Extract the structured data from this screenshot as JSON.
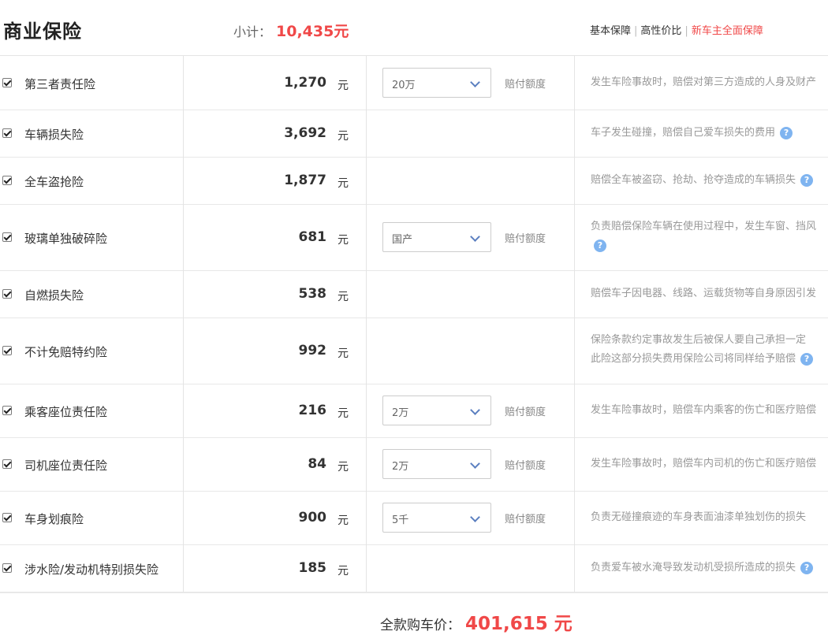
{
  "header": {
    "title": "商业保险",
    "subtotal_label": "小计：",
    "subtotal_value": "10,435元",
    "plans": [
      "基本保障",
      "高性价比",
      "新车主全面保障"
    ]
  },
  "amount_label": "赔付额度",
  "currency": "元",
  "rows": [
    {
      "name": "第三者责任险",
      "price": "1,270",
      "select": "20万",
      "desc1": "发生车险事故时，赔偿对第三方造成的人身及财产",
      "desc2": ""
    },
    {
      "name": "车辆损失险",
      "price": "3,692",
      "select": "",
      "desc1": "车子发生碰撞，赔偿自己爱车损失的费用",
      "desc2": ""
    },
    {
      "name": "全车盗抢险",
      "price": "1,877",
      "select": "",
      "desc1": "赔偿全车被盗窃、抢劫、抢夺造成的车辆损失",
      "desc2": ""
    },
    {
      "name": "玻璃单独破碎险",
      "price": "681",
      "select": "国产",
      "desc1": "负责赔偿保险车辆在使用过程中，发生车窗、挡风",
      "desc2": ""
    },
    {
      "name": "自燃损失险",
      "price": "538",
      "select": "",
      "desc1": "赔偿车子因电器、线路、运载货物等自身原因引发",
      "desc2": ""
    },
    {
      "name": "不计免赔特约险",
      "price": "992",
      "select": "",
      "desc1": "保险条款约定事故发生后被保人要自己承担一定",
      "desc2": "此险这部分损失费用保险公司将同样给予赔偿"
    },
    {
      "name": "乘客座位责任险",
      "price": "216",
      "select": "2万",
      "desc1": "发生车险事故时，赔偿车内乘客的伤亡和医疗赔偿",
      "desc2": ""
    },
    {
      "name": "司机座位责任险",
      "price": "84",
      "select": "2万",
      "desc1": "发生车险事故时，赔偿车内司机的伤亡和医疗赔偿",
      "desc2": ""
    },
    {
      "name": "车身划痕险",
      "price": "900",
      "select": "5千",
      "desc1": "负责无碰撞痕迹的车身表面油漆单独划伤的损失",
      "desc2": ""
    },
    {
      "name": "涉水险/发动机特别损失险",
      "price": "185",
      "select": "",
      "desc1": "负责爱车被水淹导致发动机受损所造成的损失",
      "desc2": ""
    }
  ],
  "footer": {
    "total_label": "全款购车价：",
    "total_value": "401,615 元"
  },
  "colors": {
    "accent": "#f04848",
    "help": "#7fb4f0"
  }
}
